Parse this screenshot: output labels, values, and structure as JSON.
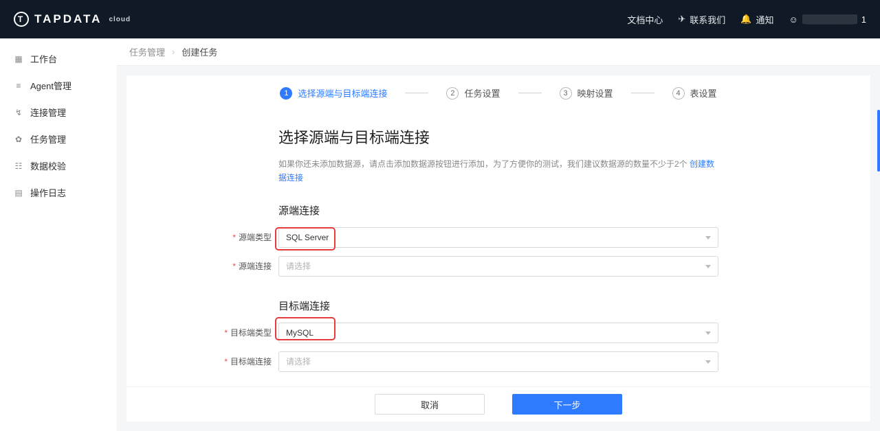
{
  "brand": {
    "name": "TAPDATA",
    "badge": "cloud",
    "logo_letter": "T"
  },
  "topbar": {
    "docs": "文档中心",
    "contact": "联系我们",
    "notify": "通知",
    "user_suffix": "1"
  },
  "sidebar": {
    "items": [
      {
        "icon": "workspace-icon",
        "glyph": "▦",
        "label": "工作台"
      },
      {
        "icon": "agent-icon",
        "glyph": "≡",
        "label": "Agent管理"
      },
      {
        "icon": "connection-icon",
        "glyph": "↯",
        "label": "连接管理"
      },
      {
        "icon": "task-icon",
        "glyph": "✿",
        "label": "任务管理"
      },
      {
        "icon": "verify-icon",
        "glyph": "☷",
        "label": "数据校验"
      },
      {
        "icon": "log-icon",
        "glyph": "▤",
        "label": "操作日志"
      }
    ]
  },
  "breadcrumb": {
    "parent": "任务管理",
    "current": "创建任务"
  },
  "steps": [
    {
      "num": "1",
      "label": "选择源端与目标端连接",
      "active": true
    },
    {
      "num": "2",
      "label": "任务设置",
      "active": false
    },
    {
      "num": "3",
      "label": "映射设置",
      "active": false
    },
    {
      "num": "4",
      "label": "表设置",
      "active": false
    }
  ],
  "form": {
    "title": "选择源端与目标端连接",
    "hint_pre": "如果你还未添加数据源，请点击添加数据源按钮进行添加，为了方便你的测试，我们建议数据源的数量不少于2个",
    "hint_link": "创建数据连接",
    "source_section": "源端连接",
    "target_section": "目标端连接",
    "source_type_label": "源端类型",
    "source_type_value": "SQL Server",
    "source_conn_label": "源端连接",
    "source_conn_placeholder": "请选择",
    "target_type_label": "目标端类型",
    "target_type_value": "MySQL",
    "target_conn_label": "目标端连接",
    "target_conn_placeholder": "请选择"
  },
  "footer": {
    "cancel": "取消",
    "next": "下一步"
  }
}
